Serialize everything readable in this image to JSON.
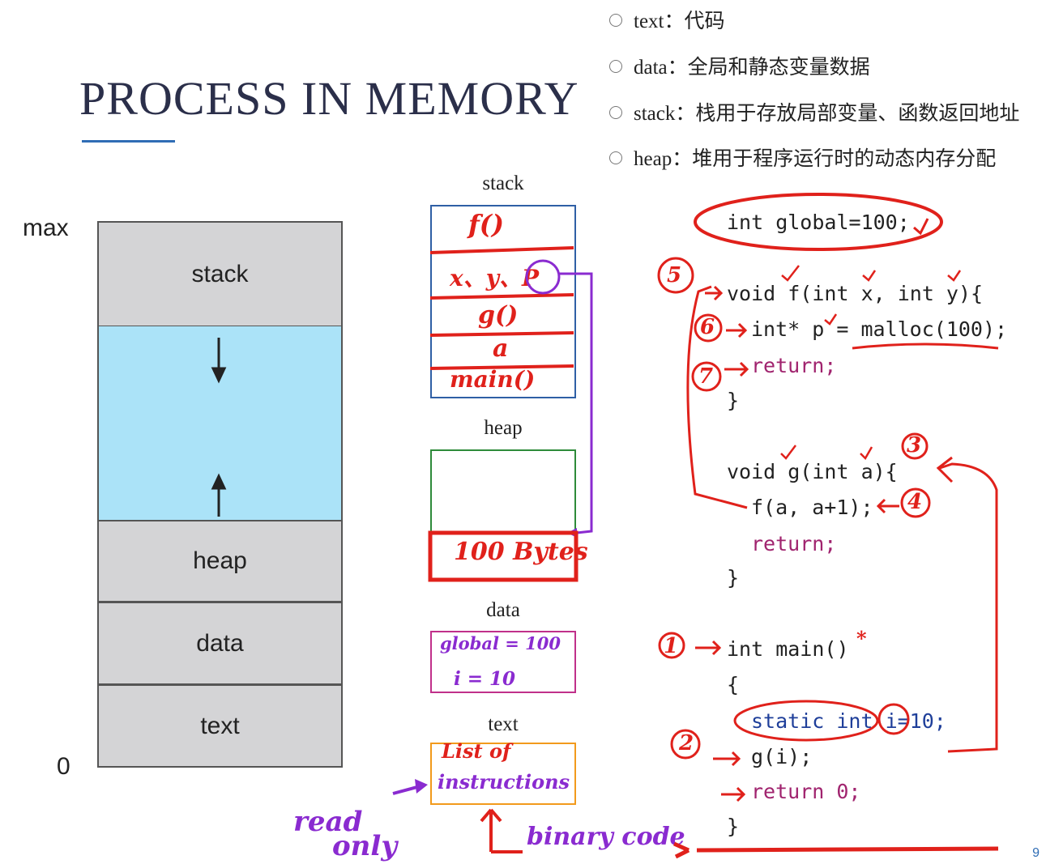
{
  "slide": {
    "title": "PROCESS IN MEMORY",
    "page_number": "9"
  },
  "bullets": [
    {
      "label": "text",
      "desc": "代码"
    },
    {
      "label": "data",
      "desc": "全局和静态变量数据"
    },
    {
      "label": "stack",
      "desc": "栈用于存放局部变量、函数返回地址"
    },
    {
      "label": "heap",
      "desc": "堆用于程序运行时的动态内存分配"
    }
  ],
  "memory": {
    "max_label": "max",
    "zero_label": "0",
    "segments": [
      "stack",
      "heap",
      "data",
      "text"
    ]
  },
  "mini": {
    "stack_label": "stack",
    "heap_label": "heap",
    "data_label": "data",
    "text_label": "text"
  },
  "code": {
    "global_line": "int global=100;",
    "f_sig": "void f(int x, int y){",
    "f_body1": "int* p = malloc(100);",
    "f_body2": "return;",
    "brace": "}",
    "g_sig": "void g(int a){",
    "g_body1": "f(a, a+1);",
    "g_body2": "return;",
    "main_sig": "int main()",
    "open_brace": "{",
    "main_body1": "static int i=10;",
    "main_body2": "g(i);",
    "main_body3": "return 0;"
  },
  "annotations": {
    "stack_frames": [
      "f()",
      "x、y、P",
      "g()",
      "a",
      "main()"
    ],
    "heap_note": "100 Bytes",
    "data_lines": [
      "global = 100",
      "i = 10"
    ],
    "text_lines": [
      "List of",
      "instructions"
    ],
    "read_only": [
      "read",
      "only"
    ],
    "binary_code": "binary code",
    "step_numbers": [
      "1",
      "2",
      "3",
      "4",
      "5",
      "6",
      "7"
    ],
    "star": "*"
  },
  "colors": {
    "title": "#2b2f4a",
    "accent_line": "#2f6db5",
    "segment_fill": "#d4d4d6",
    "free_fill": "#abe3f8",
    "stack_box": "#2f5fa5",
    "heap_box": "#2e8b3a",
    "data_box": "#c0308a",
    "text_box": "#f29a1c",
    "annotation_red": "#e0211b",
    "annotation_purple": "#8a2bd0"
  }
}
